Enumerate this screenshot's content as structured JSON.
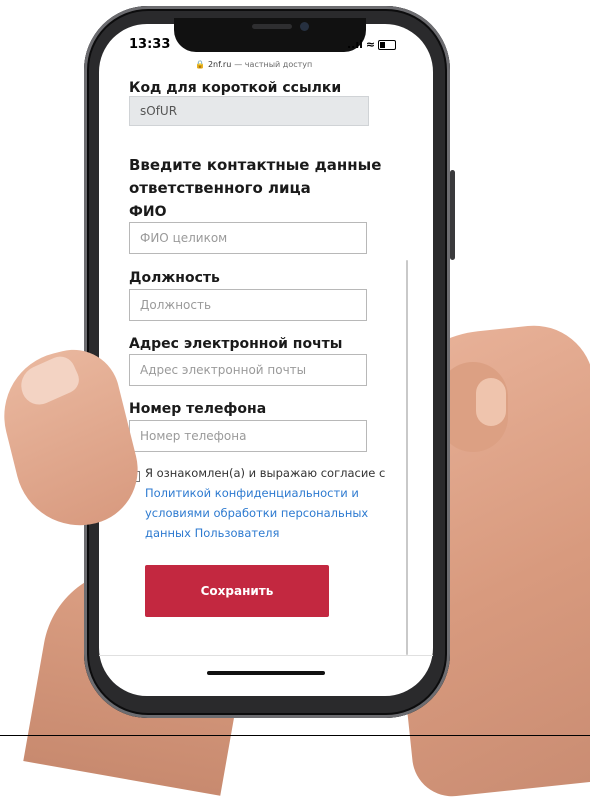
{
  "status_bar": {
    "time": "13:33",
    "signal": "..ıl",
    "wifi": "≈"
  },
  "browser": {
    "domain": "2nf.ru",
    "mode": "— частный доступ"
  },
  "form": {
    "short_code": {
      "label": "Код для короткой ссылки",
      "value": "sOfUR"
    },
    "contact_heading": "Введите контактные данные ответственного лица",
    "full_name": {
      "label": "ФИО",
      "placeholder": "ФИО целиком"
    },
    "position": {
      "label": "Должность",
      "placeholder": "Должность"
    },
    "email": {
      "label": "Адрес электронной почты",
      "placeholder": "Адрес электронной почты"
    },
    "phone": {
      "label": "Номер телефона",
      "placeholder": "Номер телефона"
    },
    "consent": {
      "checked": false,
      "text": "Я ознакомлен(а) и выражаю согласие с",
      "link_line1": "Политикой конфиденциальности и",
      "link_line2": "условиями обработки персональных",
      "link_line3": "данных Пользователя"
    },
    "save_label": "Сохранить"
  },
  "colors": {
    "accent": "#c32840",
    "link": "#2d7ad0",
    "readonly_field": "#e6e8ea"
  }
}
